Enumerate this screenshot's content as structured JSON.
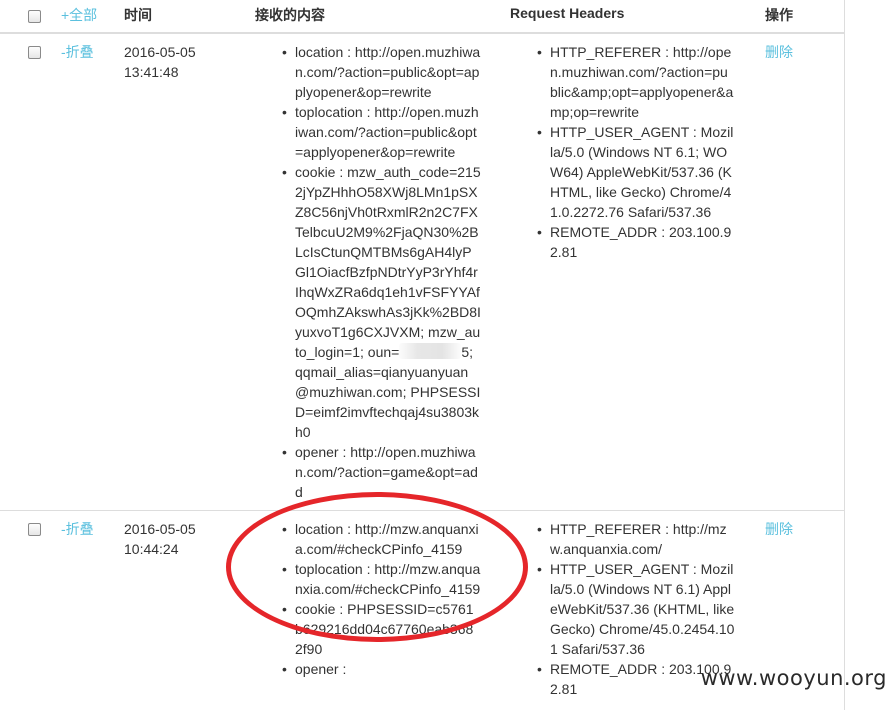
{
  "header": {
    "select_all": "+全部",
    "col_time": "时间",
    "col_content": "接收的内容",
    "col_headers": "Request Headers",
    "col_action": "操作"
  },
  "rows": [
    {
      "toggle": "-折叠",
      "date": "2016-05-05",
      "time": "13:41:48",
      "content": [
        "location : http://open.muzhiwan.com/?action=public&opt=applyopener&op=rewrite",
        "toplocation : http://open.muzhiwan.com/?action=public&opt=applyopener&op=rewrite",
        "cookie : mzw_auth_code=2152jYpZHhhO58XWj8LMn1pSXZ8C56njVh0tRxmlR2n2C7FXTelbcuU2M9%2FjaQN30%2BLcIsCtunQMTBMs6gAH4lyPGl1OiacfBzfpNDtrYyP3rYhf4rIhqWxZRa6dq1eh1vFSFYYAfOQmhZAkswhAs3jKk%2BD8IyuxvoT1g6CXJVXM; mzw_auto_login=1; oun=",
        "5; qqmail_alias=qianyuanyuan@muzhiwan.com; PHPSESSID=eimf2imvftechqaj4su3803kh0",
        "opener : http://open.muzhiwan.com/?action=game&opt=add"
      ],
      "headers": [
        "HTTP_REFERER : http://open.muzhiwan.com/?action=public&amp;opt=applyopener&amp;op=rewrite",
        "HTTP_USER_AGENT : Mozilla/5.0 (Windows NT 6.1; WOW64) AppleWebKit/537.36 (KHTML, like Gecko) Chrome/41.0.2272.76 Safari/537.36",
        "REMOTE_ADDR : 203.100.92.81"
      ],
      "action": "删除"
    },
    {
      "toggle": "-折叠",
      "date": "2016-05-05",
      "time": "10:44:24",
      "content": [
        "location : http://mzw.anquanxia.com/#checkCPinfo_4159",
        "toplocation : http://mzw.anquanxia.com/#checkCPinfo_4159",
        "cookie : PHPSESSID=c5761b629216dd04c67760eab3682f90",
        "opener :"
      ],
      "headers": [
        "HTTP_REFERER : http://mzw.anquanxia.com/",
        "HTTP_USER_AGENT : Mozilla/5.0 (Windows NT 6.1) AppleWebKit/537.36 (KHTML, like Gecko) Chrome/45.0.2454.101 Safari/537.36",
        "REMOTE_ADDR : 203.100.92.81"
      ],
      "action": "删除"
    }
  ],
  "watermark": "www.wooyun.org",
  "colors": {
    "link": "#5bc0de",
    "annotation": "#e5262a",
    "border": "#dddddd"
  }
}
